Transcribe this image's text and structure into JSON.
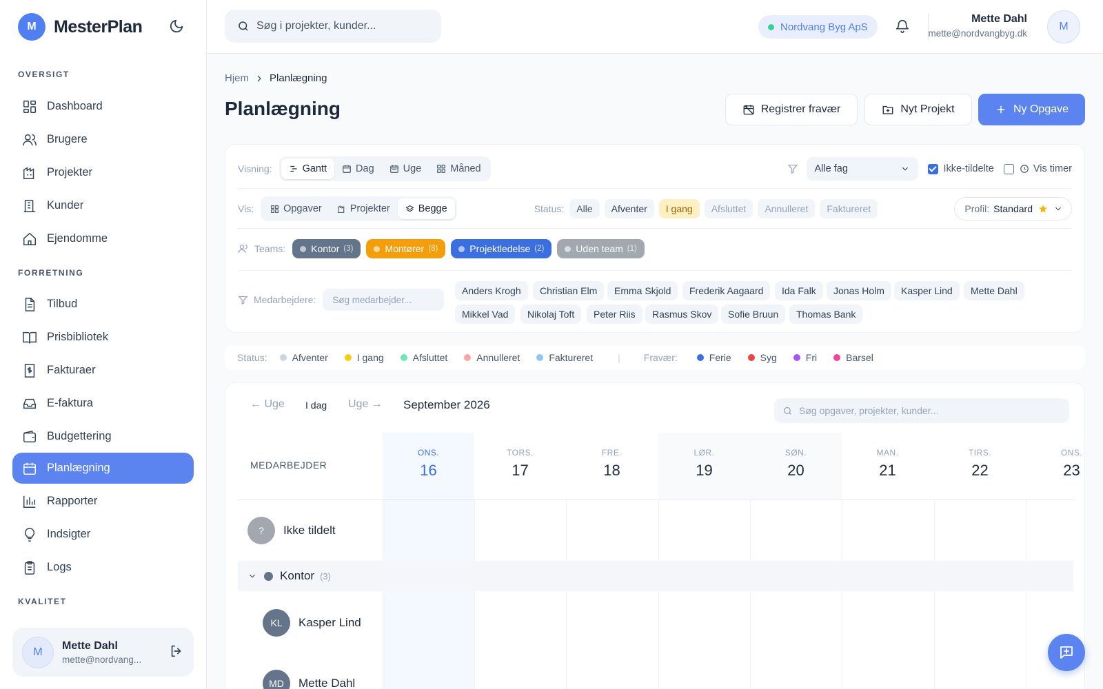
{
  "app": {
    "logo_letter": "M",
    "name": "MesterPlan"
  },
  "sidebar": {
    "sections": [
      {
        "label": "OVERSIGT"
      },
      {
        "label": "FORRETNING"
      },
      {
        "label": "KVALITET"
      }
    ],
    "items": [
      {
        "label": "Dashboard",
        "icon": "dashboard-icon"
      },
      {
        "label": "Brugere",
        "icon": "users-icon"
      },
      {
        "label": "Projekter",
        "icon": "projects-icon"
      },
      {
        "label": "Kunder",
        "icon": "customers-icon"
      },
      {
        "label": "Ejendomme",
        "icon": "home-icon"
      },
      {
        "label": "Tilbud",
        "icon": "document-icon"
      },
      {
        "label": "Prisbibliotek",
        "icon": "book-icon"
      },
      {
        "label": "Fakturaer",
        "icon": "invoice-icon"
      },
      {
        "label": "E-faktura",
        "icon": "inbox-icon"
      },
      {
        "label": "Budgettering",
        "icon": "wallet-icon"
      },
      {
        "label": "Planlægning",
        "icon": "calendar-icon",
        "active": true
      },
      {
        "label": "Rapporter",
        "icon": "chart-icon"
      },
      {
        "label": "Indsigter",
        "icon": "lightbulb-icon"
      },
      {
        "label": "Logs",
        "icon": "clipboard-icon"
      }
    ],
    "user": {
      "initial": "M",
      "name": "Mette Dahl",
      "email": "mette@nordvang..."
    }
  },
  "topbar": {
    "search_placeholder": "Søg i projekter, kunder...",
    "company": "Nordvang Byg ApS",
    "user_name": "Mette Dahl",
    "user_email": "mette@nordvangbyg.dk",
    "user_initial": "M"
  },
  "breadcrumb": {
    "home": "Hjem",
    "current": "Planlægning"
  },
  "page": {
    "title": "Planlægning",
    "btn_absence": "Registrer fravær",
    "btn_project": "Nyt Projekt",
    "btn_task": "Ny Opgave"
  },
  "filters": {
    "view_label": "Visning:",
    "views": [
      "Gantt",
      "Dag",
      "Uge",
      "Måned"
    ],
    "trade_select": "Alle fag",
    "unassigned_label": "Ikke-tildelte",
    "show_hours_label": "Vis timer",
    "show_label": "Vis:",
    "show_options": [
      "Opgaver",
      "Projekter",
      "Begge"
    ],
    "status_label": "Status:",
    "status_chips": [
      "Alle",
      "Afventer",
      "I gang",
      "Afsluttet",
      "Annulleret",
      "Faktureret"
    ],
    "profile_label": "Profil:",
    "profile_value": "Standard",
    "teams_label": "Teams:",
    "teams": [
      {
        "name": "Kontor",
        "count": "(3)",
        "color": "#64748b"
      },
      {
        "name": "Montører",
        "count": "(8)",
        "color": "#f59e0b"
      },
      {
        "name": "Projektledelse",
        "count": "(2)",
        "color": "#3b6fe0"
      },
      {
        "name": "Uden team",
        "count": "(1)",
        "color": "#a3a8b0"
      }
    ],
    "employees_label": "Medarbejdere:",
    "employees_placeholder": "Søg medarbejder...",
    "employees": [
      "Anders Krogh",
      "Christian Elm",
      "Emma Skjold",
      "Frederik Aagaard",
      "Ida Falk",
      "Jonas Holm",
      "Kasper Lind",
      "Mette Dahl",
      "Mikkel Vad",
      "Nikolaj Toft",
      "Peter Riis",
      "Rasmus Skov",
      "Sofie Bruun",
      "Thomas Bank"
    ]
  },
  "legend": {
    "status_label": "Status:",
    "status": [
      {
        "label": "Afventer",
        "color": "#cbd5e1"
      },
      {
        "label": "I gang",
        "color": "#facc15"
      },
      {
        "label": "Afsluttet",
        "color": "#6ee7b7"
      },
      {
        "label": "Annulleret",
        "color": "#fca5a5"
      },
      {
        "label": "Faktureret",
        "color": "#93c5fd"
      }
    ],
    "divider": "|",
    "absence_label": "Fravær:",
    "absence": [
      {
        "label": "Ferie",
        "color": "#3b6fe0"
      },
      {
        "label": "Syg",
        "color": "#ef4444"
      },
      {
        "label": "Fri",
        "color": "#a855f7"
      },
      {
        "label": "Barsel",
        "color": "#ec4899"
      }
    ]
  },
  "calendar": {
    "prev": "← Uge",
    "today": "I dag",
    "next": "Uge →",
    "month": "September 2026",
    "search_placeholder": "Søg opgaver, projekter, kunder...",
    "employee_header": "MEDARBEJDER",
    "days": [
      {
        "dow": "ONS.",
        "num": "16",
        "today": true
      },
      {
        "dow": "TORS.",
        "num": "17"
      },
      {
        "dow": "FRE.",
        "num": "18"
      },
      {
        "dow": "LØR.",
        "num": "19",
        "weekend": true
      },
      {
        "dow": "SØN.",
        "num": "20",
        "weekend": true
      },
      {
        "dow": "MAN.",
        "num": "21"
      },
      {
        "dow": "TIRS.",
        "num": "22"
      },
      {
        "dow": "ONS.",
        "num": "23"
      }
    ],
    "unassigned": {
      "initial": "?",
      "label": "Ikke tildelt"
    },
    "group": {
      "name": "Kontor",
      "count": "(3)"
    },
    "rows": [
      {
        "initials": "KL",
        "name": "Kasper Lind"
      },
      {
        "initials": "MD",
        "name": "Mette Dahl"
      }
    ]
  }
}
